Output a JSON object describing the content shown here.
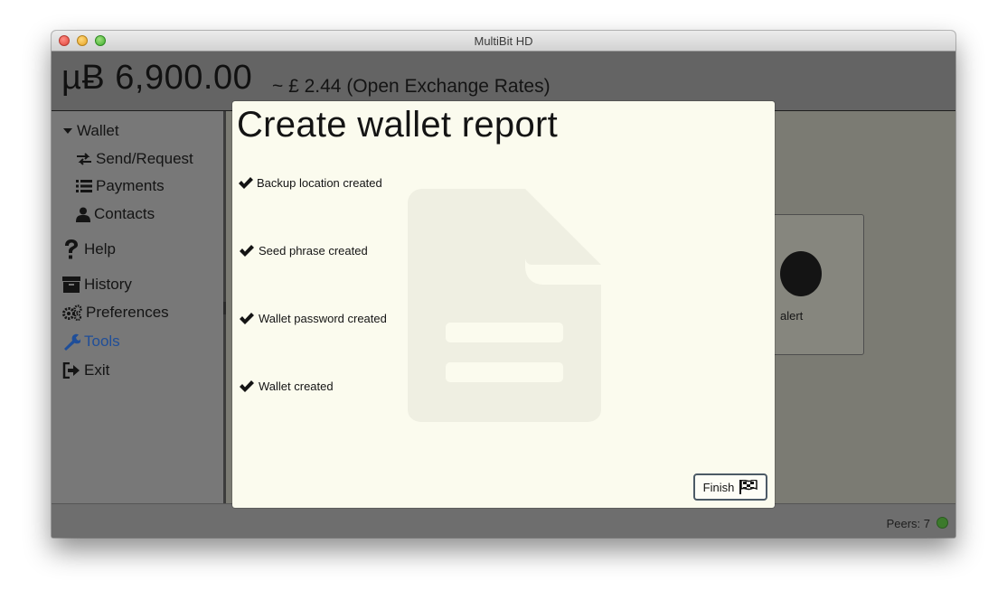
{
  "window": {
    "title": "MultiBit HD"
  },
  "header": {
    "balance": "µɃ 6,900.00",
    "fiat": "~ £ 2.44 (Open Exchange Rates)"
  },
  "sidebar": {
    "items": [
      {
        "label": "Wallet",
        "icon": "caret-down-icon"
      },
      {
        "label": "Send/Request",
        "icon": "exchange-icon"
      },
      {
        "label": "Payments",
        "icon": "list-icon"
      },
      {
        "label": "Contacts",
        "icon": "user-icon"
      },
      {
        "label": "Help",
        "icon": "question-icon"
      },
      {
        "label": "History",
        "icon": "archive-icon"
      },
      {
        "label": "Preferences",
        "icon": "cogs-icon"
      },
      {
        "label": "Tools",
        "icon": "wrench-icon",
        "active": true,
        "active_color": "#1f4e99"
      },
      {
        "label": "Exit",
        "icon": "sign-out-icon"
      }
    ]
  },
  "background": {
    "card_label": "alert"
  },
  "dialog": {
    "title": "Create wallet report",
    "steps": [
      {
        "label": "Backup location created",
        "icon": "check-icon"
      },
      {
        "label": "Seed phrase created",
        "icon": "check-icon"
      },
      {
        "label": "Wallet password created",
        "icon": "check-icon"
      },
      {
        "label": "Wallet created",
        "icon": "check-icon"
      }
    ],
    "finish_label": "Finish",
    "finish_icon": "flag-checkered-icon",
    "watermark_icon": "file-text-icon"
  },
  "status": {
    "peers": "Peers: 7",
    "peer_color": "#3c7a2c"
  }
}
